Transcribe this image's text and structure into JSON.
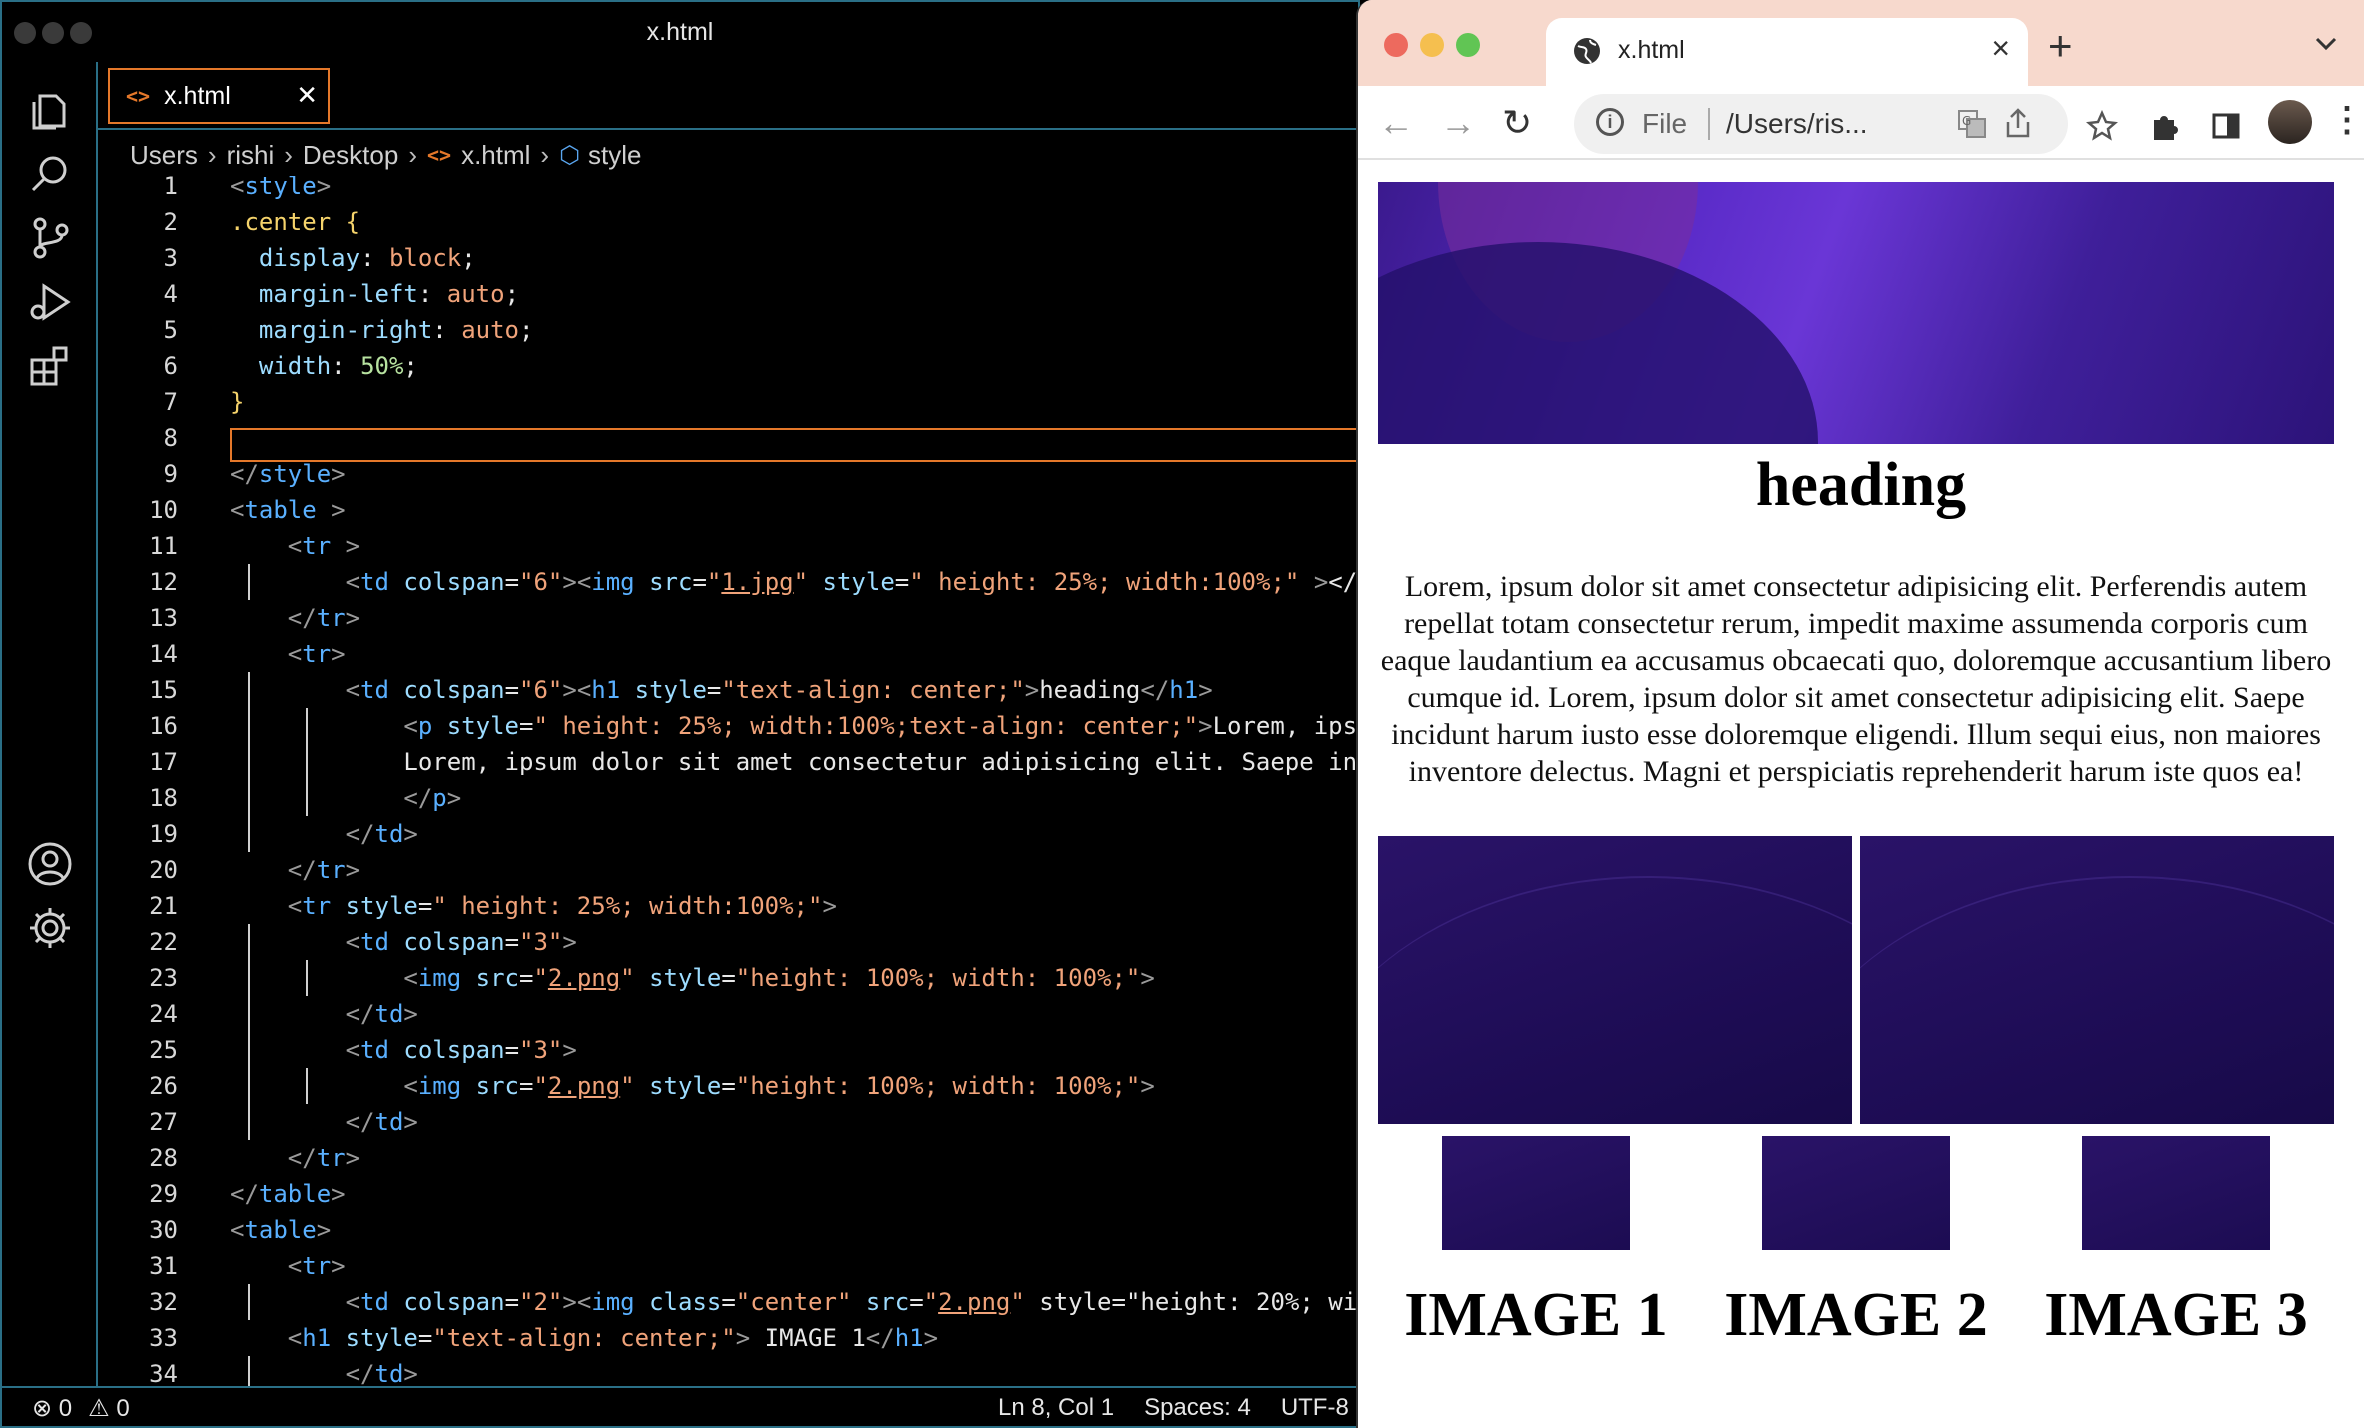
{
  "vscode": {
    "window_title": "x.html",
    "tab": {
      "label": "x.html"
    },
    "breadcrumb": [
      "Users",
      "rishi",
      "Desktop",
      "x.html",
      "style"
    ],
    "status": {
      "errors": "0",
      "warnings": "0",
      "position": "Ln 8, Col 1",
      "spaces": "Spaces: 4",
      "encoding": "UTF-8"
    },
    "activity_icons": [
      "explorer-icon",
      "search-icon",
      "source-control-icon",
      "run-debug-icon",
      "extensions-icon",
      "account-icon",
      "settings-gear-icon"
    ]
  },
  "code_lines": [
    {
      "n": "1",
      "text": "<style>"
    },
    {
      "n": "2",
      "text": ".center {"
    },
    {
      "n": "3",
      "text": "  display: block;"
    },
    {
      "n": "4",
      "text": "  margin-left: auto;"
    },
    {
      "n": "5",
      "text": "  margin-right: auto;"
    },
    {
      "n": "6",
      "text": "  width: 50%;"
    },
    {
      "n": "7",
      "text": "}"
    },
    {
      "n": "8",
      "text": ""
    },
    {
      "n": "9",
      "text": "</style>"
    },
    {
      "n": "10",
      "text": "<table >"
    },
    {
      "n": "11",
      "text": "    <tr >"
    },
    {
      "n": "12",
      "text": "        <td colspan=\"6\"><img src=\"1.jpg\" style=\" height: 25%; width:100%;\" ></"
    },
    {
      "n": "13",
      "text": "    </tr>"
    },
    {
      "n": "14",
      "text": "    <tr>"
    },
    {
      "n": "15",
      "text": "        <td colspan=\"6\"><h1 style=\"text-align: center;\">heading</h1>"
    },
    {
      "n": "16",
      "text": "            <p style=\" height: 25%; width:100%;text-align: center;\">Lorem, ips"
    },
    {
      "n": "17",
      "text": "            Lorem, ipsum dolor sit amet consectetur adipisicing elit. Saepe in"
    },
    {
      "n": "18",
      "text": "            </p>"
    },
    {
      "n": "19",
      "text": "        </td>"
    },
    {
      "n": "20",
      "text": "    </tr>"
    },
    {
      "n": "21",
      "text": "    <tr style=\" height: 25%; width:100%;\">"
    },
    {
      "n": "22",
      "text": "        <td colspan=\"3\">"
    },
    {
      "n": "23",
      "text": "            <img src=\"2.png\" style=\"height: 100%; width: 100%;\">"
    },
    {
      "n": "24",
      "text": "        </td>"
    },
    {
      "n": "25",
      "text": "        <td colspan=\"3\">"
    },
    {
      "n": "26",
      "text": "            <img src=\"2.png\" style=\"height: 100%; width: 100%;\">"
    },
    {
      "n": "27",
      "text": "        </td>"
    },
    {
      "n": "28",
      "text": "    </tr>"
    },
    {
      "n": "29",
      "text": "</table>"
    },
    {
      "n": "30",
      "text": "<table>"
    },
    {
      "n": "31",
      "text": "    <tr>"
    },
    {
      "n": "32",
      "text": "        <td colspan=\"2\"><img class=\"center\" src=\"2.png\" style=\"height: 20%; wi"
    },
    {
      "n": "33",
      "text": "    <h1 style=\"text-align: center;\"> IMAGE 1</h1>"
    },
    {
      "n": "34",
      "text": "        </td>"
    }
  ],
  "browser": {
    "tab_title": "x.html",
    "omnibox": {
      "scheme": "File",
      "url": "/Users/ris..."
    },
    "page": {
      "heading": "heading",
      "paragraph": "Lorem, ipsum dolor sit amet consectetur adipisicing elit. Perferendis autem repellat totam consectetur rerum, impedit maxime assumenda corporis cum eaque laudantium ea accusamus obcaecati quo, doloremque accusantium libero cumque id. Lorem, ipsum dolor sit amet consectetur adipisicing elit. Saepe incidunt harum iusto esse doloremque eligendi. Illum sequi eius, non maiores inventore delectus. Magni et perspiciatis reprehenderit harum iste quos ea!",
      "captions": [
        "IMAGE 1",
        "IMAGE 2",
        "IMAGE 3"
      ]
    }
  },
  "colors": {
    "accent_orange": "#e5782a",
    "border_teal": "#2a6f86",
    "tag_blue": "#5ab0ff",
    "string_orange": "#f0a37a"
  }
}
